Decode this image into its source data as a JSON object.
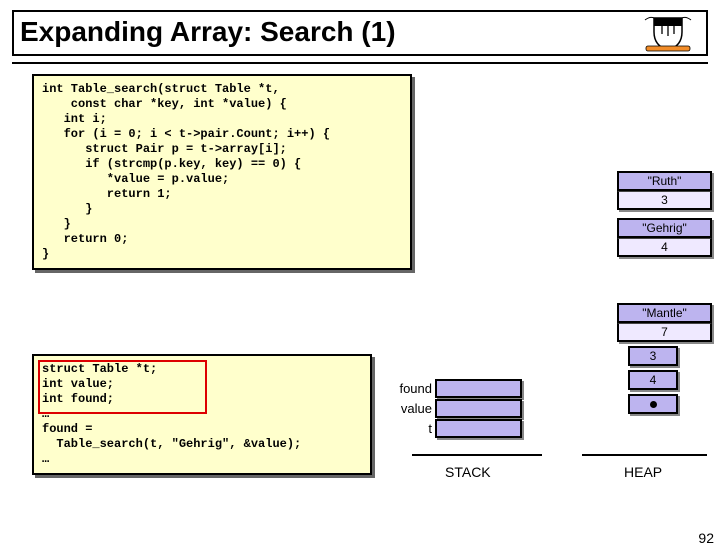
{
  "title": "Expanding Array: Search (1)",
  "code1": "int Table_search(struct Table *t,\n    const char *key, int *value) {\n   int i;\n   for (i = 0; i < t->pair.Count; i++) {\n      struct Pair p = t->array[i];\n      if (strcmp(p.key, key) == 0) {\n         *value = p.value;\n         return 1;\n      }\n   }\n   return 0;\n}",
  "code2_decl": "struct Table *t;\nint value;\nint found;\n…",
  "code2_call": "found =\n  Table_search(t, \"Gehrig\", &value);\n…",
  "heap": [
    {
      "key": "\"Ruth\"",
      "val": "3"
    },
    {
      "key": "\"Gehrig\"",
      "val": "4"
    },
    {
      "key": "\"Mantle\"",
      "val": "7"
    }
  ],
  "mini": {
    "r0": "3",
    "r1": "4"
  },
  "stack_labels": {
    "found": "found",
    "value": "value",
    "t": "t"
  },
  "captions": {
    "stack": "STACK",
    "heap": "HEAP"
  },
  "slide_number": "92"
}
